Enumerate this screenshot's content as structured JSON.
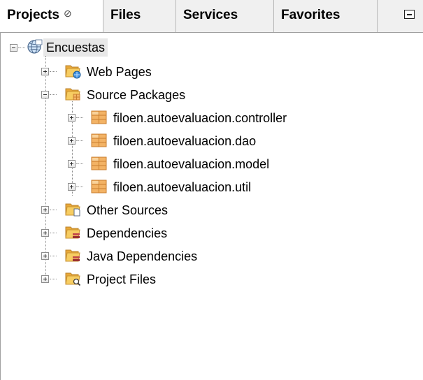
{
  "tabs": [
    {
      "label": "Projects",
      "close_glyph": "⊘",
      "active": true
    },
    {
      "label": "Files"
    },
    {
      "label": "Services"
    },
    {
      "label": "Favorites"
    }
  ],
  "tree": {
    "root": {
      "label": "Encuestas",
      "icon": "globe-icon"
    },
    "folders": [
      {
        "label": "Web Pages",
        "icon": "web-pages-folder-icon"
      },
      {
        "label": "Source Packages",
        "icon": "source-packages-folder-icon"
      },
      {
        "label": "Other Sources",
        "icon": "other-sources-folder-icon"
      },
      {
        "label": "Dependencies",
        "icon": "dependencies-folder-icon"
      },
      {
        "label": "Java Dependencies",
        "icon": "java-dependencies-folder-icon"
      },
      {
        "label": "Project Files",
        "icon": "project-files-folder-icon"
      }
    ],
    "packages": [
      {
        "label": "filoen.autoevaluacion.controller",
        "icon": "package-icon"
      },
      {
        "label": "filoen.autoevaluacion.dao",
        "icon": "package-icon"
      },
      {
        "label": "filoen.autoevaluacion.model",
        "icon": "package-icon"
      },
      {
        "label": "filoen.autoevaluacion.util",
        "icon": "package-icon"
      }
    ]
  },
  "colors": {
    "folder": "#f4c04a",
    "package": "#f0a050",
    "selection": "#e8e8e8"
  }
}
